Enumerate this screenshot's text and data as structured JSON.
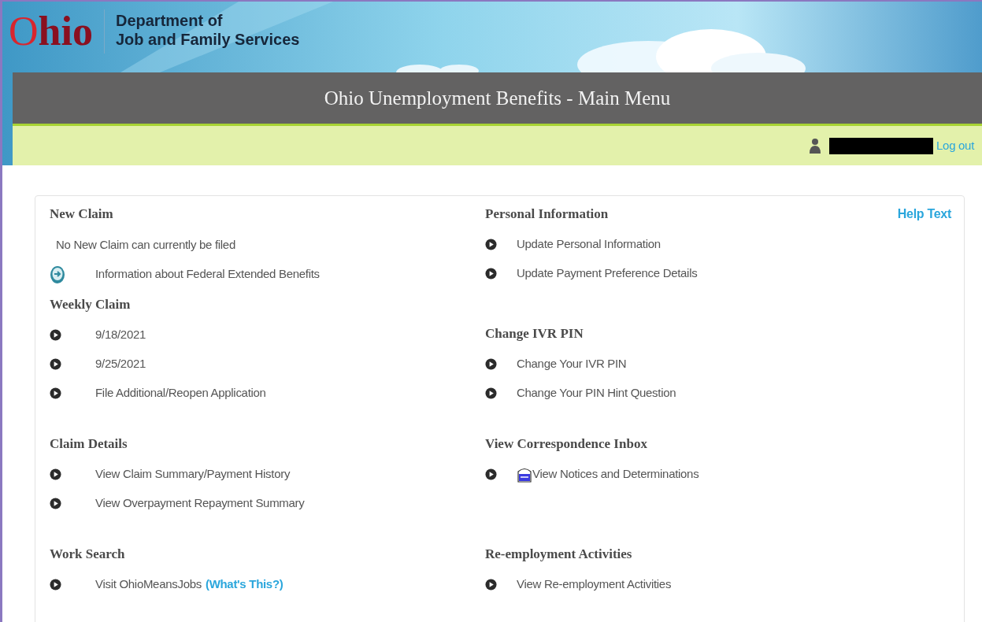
{
  "header": {
    "logo": "Ohio",
    "department_lines": [
      "Department of",
      "Job and Family Services"
    ]
  },
  "title": "Ohio Unemployment Benefits - Main Menu",
  "user_bar": {
    "logout": "Log out"
  },
  "help_link": "Help Text",
  "bands": [
    {
      "left": [
        {
          "heading": "New Claim",
          "items": [
            {
              "kind": "note",
              "label": "No New Claim can currently be filed"
            },
            {
              "kind": "info",
              "label": "Information about Federal Extended Benefits"
            }
          ]
        },
        {
          "heading": "Weekly Claim",
          "items": [
            {
              "kind": "link",
              "label": "9/18/2021"
            },
            {
              "kind": "link",
              "label": "9/25/2021"
            },
            {
              "kind": "link",
              "label": "File Additional/Reopen Application"
            }
          ]
        }
      ],
      "right": [
        {
          "heading": "Personal Information",
          "items": [
            {
              "kind": "link",
              "label": "Update Personal Information"
            },
            {
              "kind": "link",
              "label": "Update Payment Preference Details"
            }
          ]
        },
        {
          "heading": "Change IVR PIN",
          "items": [
            {
              "kind": "link",
              "label": "Change Your IVR PIN"
            },
            {
              "kind": "link",
              "label": "Change Your PIN Hint Question"
            }
          ]
        }
      ]
    },
    {
      "left": [
        {
          "heading": "Claim Details",
          "items": [
            {
              "kind": "link",
              "label": "View Claim Summary/Payment History"
            },
            {
              "kind": "link",
              "label": "View Overpayment Repayment Summary"
            }
          ]
        }
      ],
      "right": [
        {
          "heading": "View Correspondence Inbox",
          "items": [
            {
              "kind": "notice",
              "label": "View Notices and Determinations"
            }
          ]
        }
      ]
    },
    {
      "left": [
        {
          "heading": "Work Search",
          "items": [
            {
              "kind": "link",
              "label": "Visit OhioMeansJobs",
              "help": "(What's This?)"
            }
          ]
        }
      ],
      "right": [
        {
          "heading": "Re-employment Activities",
          "items": [
            {
              "kind": "link",
              "label": "View Re-employment Activities"
            }
          ]
        }
      ]
    }
  ]
}
